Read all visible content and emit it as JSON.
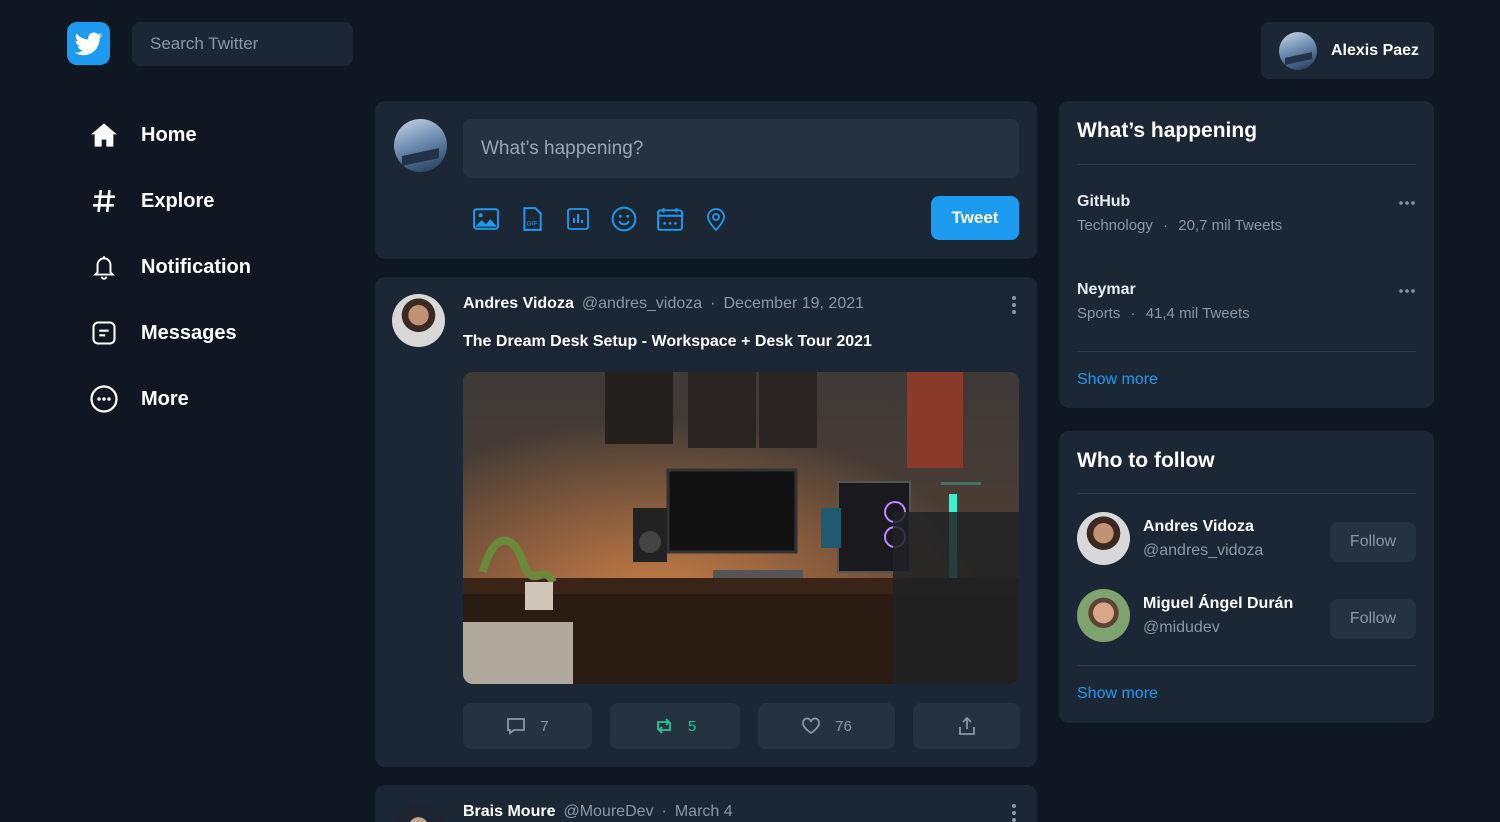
{
  "app": {
    "title": "Twitter"
  },
  "search": {
    "placeholder": "Search Twitter"
  },
  "profile": {
    "name": "Alexis Paez"
  },
  "nav": {
    "items": [
      {
        "label": "Home",
        "icon": "home-icon"
      },
      {
        "label": "Explore",
        "icon": "hashtag-icon"
      },
      {
        "label": "Notification",
        "icon": "bell-icon"
      },
      {
        "label": "Messages",
        "icon": "message-icon"
      },
      {
        "label": "More",
        "icon": "more-icon"
      }
    ]
  },
  "composer": {
    "placeholder": "What’s happening?",
    "tools": [
      "image-icon",
      "gif-icon",
      "poll-icon",
      "emoji-icon",
      "schedule-icon",
      "location-icon"
    ],
    "tweet_label": "Tweet"
  },
  "post": {
    "author": "Andres Vidoza",
    "handle": "@andres_vidoza",
    "sep": "·",
    "date": "December 19, 2021",
    "text": "The Dream Desk Setup - Workspace + Desk Tour 2021",
    "replies": "7",
    "retweets": "5",
    "likes": "76"
  },
  "post2": {
    "author": "Brais Moure",
    "handle": "@MoureDev",
    "sep": "·",
    "date": "March 4"
  },
  "trends": {
    "title": "What’s happening",
    "items": [
      {
        "name": "GitHub",
        "category": "Technology",
        "sep": "·",
        "count": "20,7 mil Tweets"
      },
      {
        "name": "Neymar",
        "category": "Sports",
        "sep": "·",
        "count": "41,4 mil Tweets"
      }
    ],
    "show_more": "Show more"
  },
  "follow": {
    "title": "Who to follow",
    "items": [
      {
        "name": "Andres Vidoza",
        "handle": "@andres_vidoza",
        "button": "Follow"
      },
      {
        "name": "Miguel Ángel Durán",
        "handle": "@midudev",
        "button": "Follow"
      }
    ],
    "show_more": "Show more"
  },
  "colors": {
    "accent": "#1d9bf0",
    "background": "#0f1822",
    "card": "#1b2734",
    "retweet": "#20c997"
  }
}
